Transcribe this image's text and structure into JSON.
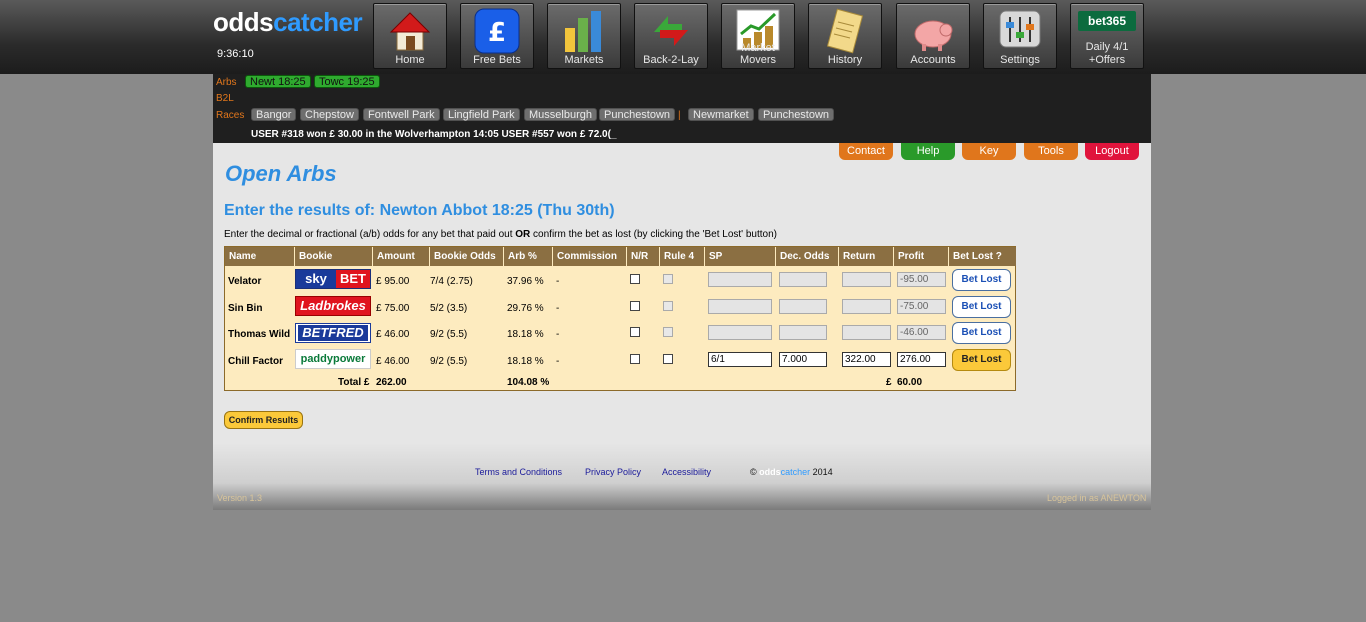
{
  "header": {
    "logo_part1": "odds",
    "logo_part2": "catcher",
    "clock": "9:36:10",
    "nav": [
      {
        "label": "Home",
        "icon": "house-icon"
      },
      {
        "label": "Free Bets",
        "icon": "pound-icon"
      },
      {
        "label": "Markets",
        "icon": "bar-chart-icon"
      },
      {
        "label": "Back-2-Lay",
        "icon": "arrows-icon"
      },
      {
        "label": "Market Movers",
        "icon": "trend-chart-icon"
      },
      {
        "label": "History",
        "icon": "scroll-icon"
      },
      {
        "label": "Accounts",
        "icon": "piggy-bank-icon"
      },
      {
        "label": "Settings",
        "icon": "sliders-icon"
      },
      {
        "label1": "Daily 4/1",
        "label2": "+Offers",
        "brand": "bet365"
      }
    ]
  },
  "subbar": {
    "arbs_label": "Arbs",
    "b2l_label": "B2L",
    "races_label": "Races",
    "arbs": [
      "Newt 18:25",
      "Towc 19:25"
    ],
    "races": [
      "Bangor",
      "Chepstow",
      "Fontwell Park",
      "Lingfield Park",
      "Musselburgh",
      "Punchestown",
      "Newmarket",
      "Punchestown"
    ],
    "separator": "|",
    "ticker": "USER #318 won £ 30.00 in the Wolverhampton 14:05     USER #557 won £ 72.0(_"
  },
  "toplinks": [
    {
      "label": "Contact",
      "color": "#e0761c"
    },
    {
      "label": "Help",
      "color": "#2a9a2a"
    },
    {
      "label": "Key",
      "color": "#e0761c"
    },
    {
      "label": "Tools",
      "color": "#e0761c"
    },
    {
      "label": "Logout",
      "color": "#e0143c"
    }
  ],
  "main": {
    "title": "Open Arbs",
    "subtitle": "Enter the results of: Newton Abbot 18:25 (Thu 30th)",
    "instruction_pre": "Enter the decimal or fractional (a/b) odds for any bet that paid out ",
    "instruction_bold": "OR",
    "instruction_post": " confirm the bet as lost (by clicking the 'Bet Lost' button)",
    "columns": [
      "Name",
      "Bookie",
      "Amount",
      "Bookie Odds",
      "Arb %",
      "Commission",
      "N/R",
      "Rule 4",
      "SP",
      "Dec. Odds",
      "Return",
      "Profit",
      "Bet Lost ?"
    ],
    "rows": [
      {
        "name": "Velator",
        "bookie": "sky BET",
        "amount": "£ 95.00",
        "odds": "7/4 (2.75)",
        "arb": "37.96 %",
        "commission": "-",
        "sp": "",
        "dec": "",
        "ret": "",
        "profit": "-95.00",
        "btn": "Bet Lost"
      },
      {
        "name": "Sin Bin",
        "bookie": "Ladbrokes",
        "amount": "£ 75.00",
        "odds": "5/2 (3.5)",
        "arb": "29.76 %",
        "commission": "-",
        "sp": "",
        "dec": "",
        "ret": "",
        "profit": "-75.00",
        "btn": "Bet Lost"
      },
      {
        "name": "Thomas Wild",
        "bookie": "BETFRED",
        "amount": "£ 46.00",
        "odds": "9/2 (5.5)",
        "arb": "18.18 %",
        "commission": "-",
        "sp": "",
        "dec": "",
        "ret": "",
        "profit": "-46.00",
        "btn": "Bet Lost"
      },
      {
        "name": "Chill Factor",
        "bookie": "paddypower",
        "amount": "£ 46.00",
        "odds": "9/2 (5.5)",
        "arb": "18.18 %",
        "commission": "-",
        "sp": "6/1",
        "dec": "7.000",
        "ret": "322.00",
        "profit": "276.00",
        "btn": "Bet Lost"
      }
    ],
    "total_label": "Total £",
    "total_amount": "262.00",
    "total_arb": "104.08 %",
    "total_currency": "£",
    "total_profit": "60.00",
    "confirm_label": "Confirm Results"
  },
  "footer": {
    "terms": "Terms and Conditions",
    "privacy": "Privacy Policy",
    "access": "Accessibility",
    "copy_pre": "© ",
    "copy_brand1": "odds",
    "copy_brand2": "catcher",
    "copy_year": " 2014",
    "version": "Version 1.3",
    "logged": "Logged in as ANEWTON"
  }
}
